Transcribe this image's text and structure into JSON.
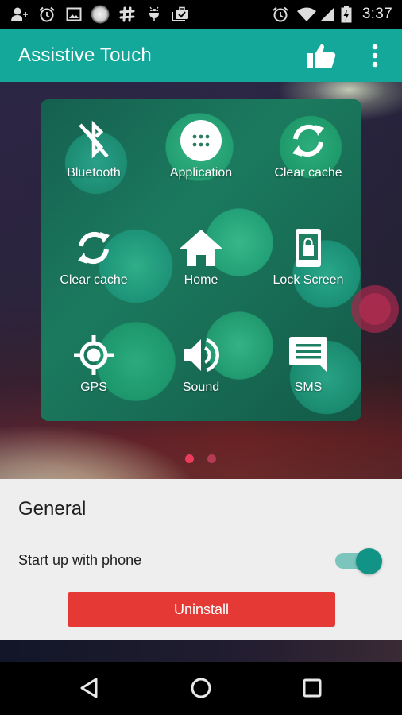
{
  "status_bar": {
    "left_icons": [
      "add-contact-icon",
      "alarm-icon",
      "image-icon",
      "circle-app-icon",
      "slack-hash-icon",
      "android-debug-icon",
      "briefcase-check-icon"
    ],
    "right_icons": [
      "alarm-icon",
      "wifi-icon",
      "cell-signal-icon",
      "battery-charging-icon"
    ],
    "time": "3:37"
  },
  "app_bar": {
    "title": "Assistive Touch",
    "actions": [
      "thumbs-up-icon",
      "more-vert-icon"
    ],
    "color": "#14a89b"
  },
  "panel": {
    "items": [
      {
        "label": "Bluetooth",
        "icon": "bluetooth-disabled-icon"
      },
      {
        "label": "Application",
        "icon": "apps-grid-icon"
      },
      {
        "label": "Clear cache",
        "icon": "refresh-icon"
      },
      {
        "label": "Clear cache",
        "icon": "refresh-icon"
      },
      {
        "label": "Home",
        "icon": "home-icon"
      },
      {
        "label": "Lock Screen",
        "icon": "lock-screen-icon"
      },
      {
        "label": "GPS",
        "icon": "gps-icon"
      },
      {
        "label": "Sound",
        "icon": "volume-icon"
      },
      {
        "label": "SMS",
        "icon": "sms-icon"
      }
    ]
  },
  "pager": {
    "pages": 2,
    "active_page": 1,
    "active_color": "#ec3c5c"
  },
  "settings": {
    "section_title": "General",
    "start_up_label": "Start up with phone",
    "start_up_enabled": true,
    "toggle_color": "#119485",
    "uninstall_label": "Uninstall",
    "uninstall_color": "#e53935"
  },
  "nav_bar": {
    "buttons": [
      "back-icon",
      "home-circle-icon",
      "recents-icon"
    ]
  }
}
